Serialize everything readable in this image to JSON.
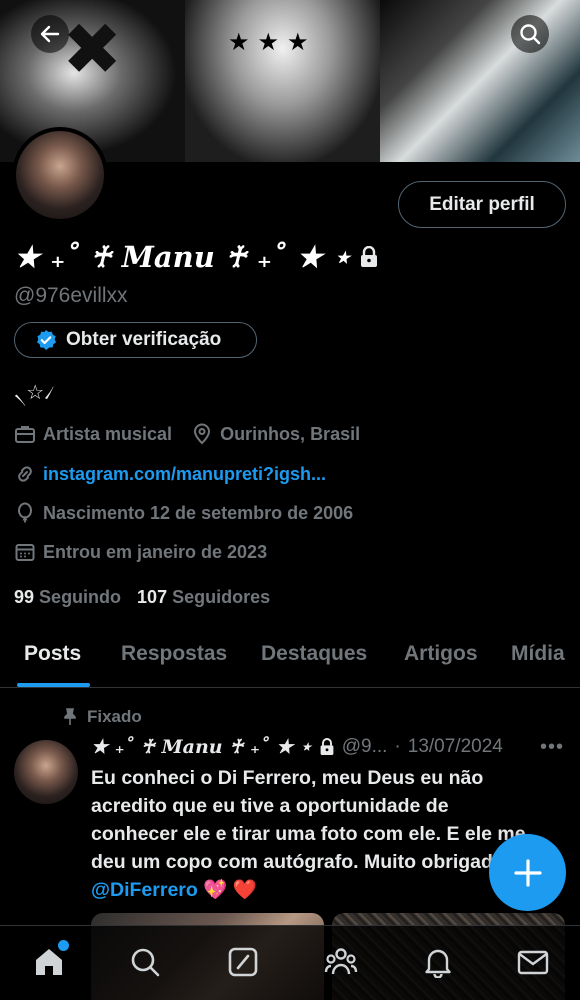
{
  "profile": {
    "name": "★ ₊˚ ♰ Manu ♰ ₊˚ ★ ⋆",
    "handle": "@976evillxx",
    "edit_label": "Editar perfil",
    "verification_label": "Obter verificação",
    "bio": "৲☆৴",
    "category": "Artista musical",
    "location": "Ourinhos, Brasil",
    "link": "instagram.com/manupreti?igsh...",
    "birthday": "Nascimento 12 de setembro de 2006",
    "joined": "Entrou em janeiro de 2023",
    "following_count": "99",
    "following_label": "Seguindo",
    "followers_count": "107",
    "followers_label": "Seguidores"
  },
  "tabs": [
    "Posts",
    "Respostas",
    "Destaques",
    "Artigos",
    "Mídia"
  ],
  "post": {
    "pinned_label": "Fixado",
    "author_name": "★ ₊˚ ♰ Manu ♰ ₊˚ ★ ⋆",
    "author_handle": "@9...",
    "separator": "·",
    "date": "13/07/2024",
    "text": "Eu conheci o Di Ferrero, meu Deus eu não acredito que eu tive a oportunidade de conhecer ele e tirar uma foto com ele. E ele me deu um copo com autógrafo. Muito obrigada",
    "mention": "@DiFerrero",
    "emojis": "💖 ❤️"
  },
  "colors": {
    "accent": "#1d9bf0",
    "muted": "#71767b",
    "text": "#e7e9ea",
    "background": "#000000"
  },
  "icons": {
    "back": "arrow-left-icon",
    "search": "search-icon",
    "lock": "lock-icon",
    "verified": "verified-badge-icon",
    "category": "briefcase-icon",
    "location": "location-pin-icon",
    "link": "link-icon",
    "birthday": "balloon-icon",
    "joined": "calendar-icon",
    "pinned": "pin-icon",
    "compose": "plus-icon",
    "nav": [
      "home-icon",
      "search-icon",
      "grok-icon",
      "communities-icon",
      "notifications-icon",
      "messages-icon"
    ]
  }
}
